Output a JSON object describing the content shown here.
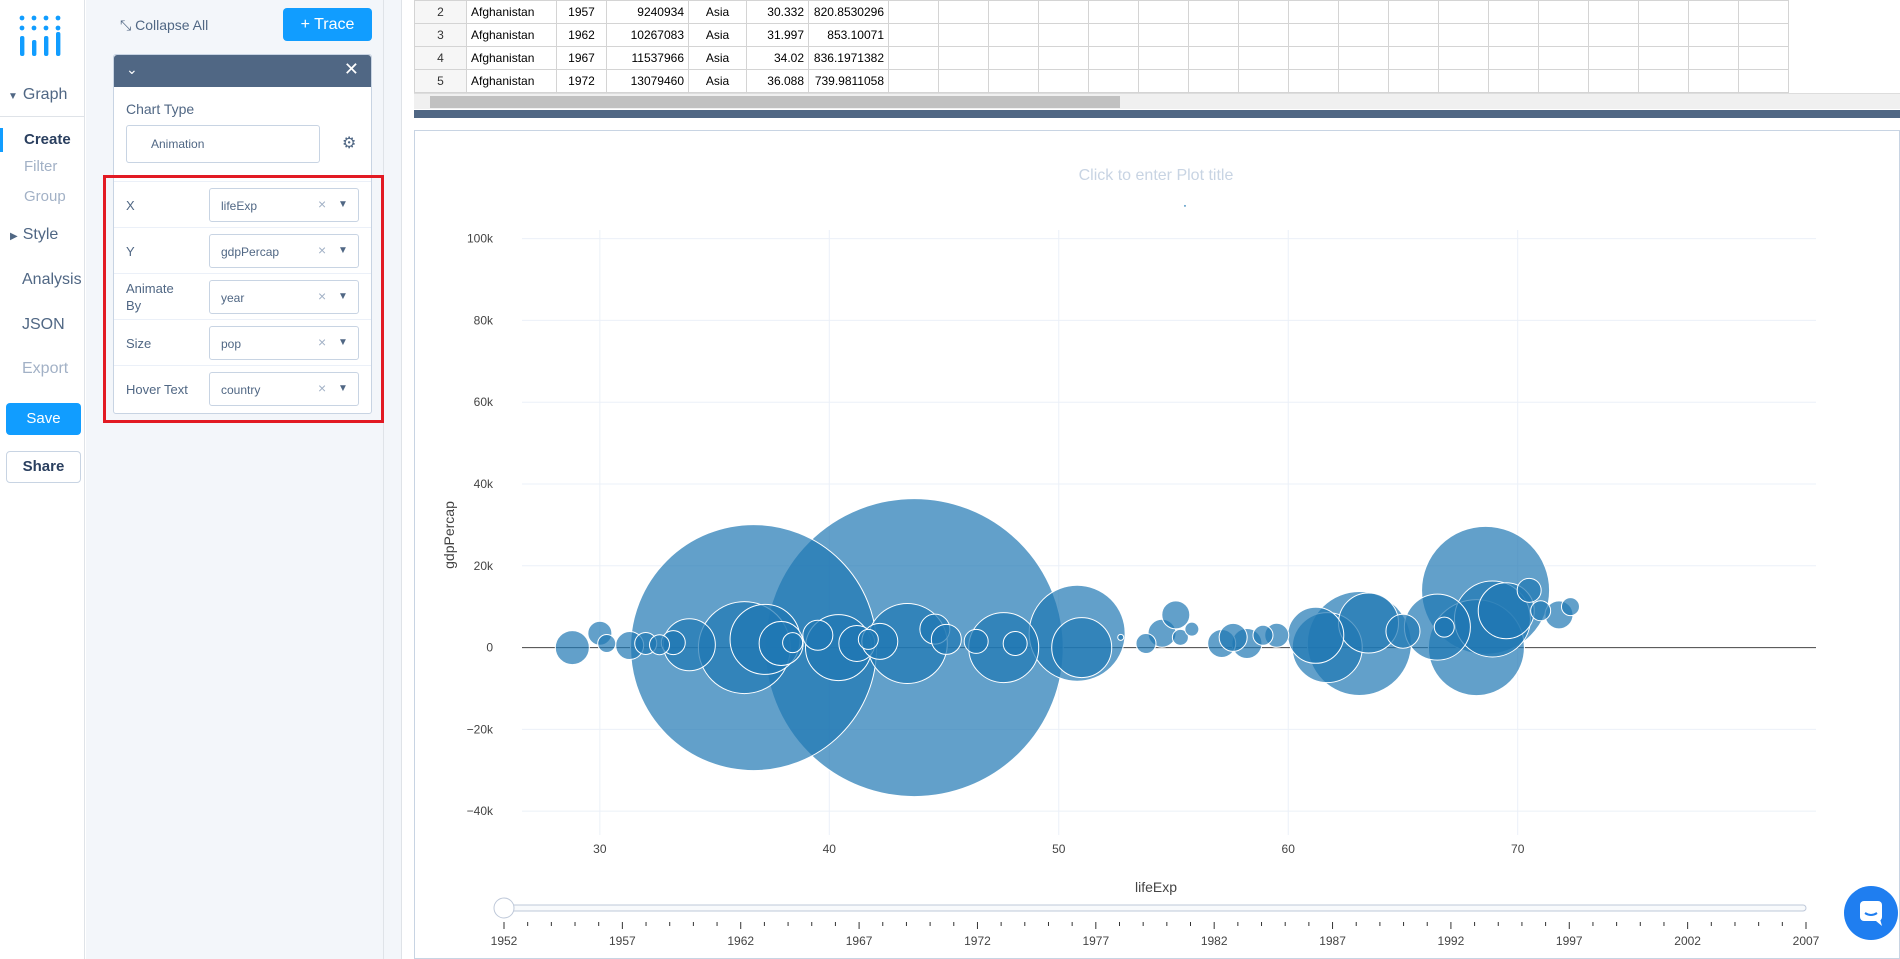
{
  "nav": {
    "graph_label": "Graph",
    "create_label": "Create",
    "filter_label": "Filter",
    "group_label": "Group",
    "style_label": "Style",
    "analysis_label": "Analysis",
    "json_label": "JSON",
    "export_label": "Export",
    "save_label": "Save",
    "share_label": "Share"
  },
  "panel": {
    "collapse_all_label": "Collapse All",
    "add_trace_label": "+ Trace",
    "chart_type_label": "Chart Type",
    "chart_type_value": "Animation",
    "fields": [
      {
        "label": "X",
        "value": "lifeExp"
      },
      {
        "label": "Y",
        "value": "gdpPercap"
      },
      {
        "label": "Animate By",
        "value": "year"
      },
      {
        "label": "Size",
        "value": "pop"
      },
      {
        "label": "Hover Text",
        "value": "country"
      }
    ]
  },
  "grid": {
    "rows": [
      {
        "n": "2",
        "country": "Afghanistan",
        "year": "1957",
        "pop": "9240934",
        "continent": "Asia",
        "lifeExp": "30.332",
        "gdpPercap": "820.8530296"
      },
      {
        "n": "3",
        "country": "Afghanistan",
        "year": "1962",
        "pop": "10267083",
        "continent": "Asia",
        "lifeExp": "31.997",
        "gdpPercap": "853.10071"
      },
      {
        "n": "4",
        "country": "Afghanistan",
        "year": "1967",
        "pop": "11537966",
        "continent": "Asia",
        "lifeExp": "34.02",
        "gdpPercap": "836.1971382"
      },
      {
        "n": "5",
        "country": "Afghanistan",
        "year": "1972",
        "pop": "13079460",
        "continent": "Asia",
        "lifeExp": "36.088",
        "gdpPercap": "739.9811058"
      }
    ]
  },
  "plot": {
    "title_placeholder": "Click to enter Plot title",
    "marker_color": "#1f77b4",
    "accent_color": "#119dff",
    "slider_years": [
      "1952",
      "1957",
      "1962",
      "1967",
      "1972",
      "1977",
      "1982",
      "1987",
      "1992",
      "1997",
      "2002",
      "2007"
    ],
    "slider_current": "1952"
  },
  "chart_data": {
    "type": "scatter",
    "xlabel": "lifeExp",
    "ylabel": "gdpPercap",
    "xlim": [
      25.3,
      83
    ],
    "ylim": [
      -49500,
      118000
    ],
    "x_ticks": [
      30,
      40,
      50,
      60,
      70
    ],
    "y_ticks": [
      -40000,
      -20000,
      0,
      20000,
      40000,
      60000,
      80000,
      100000
    ],
    "y_tick_labels": [
      "−40k",
      "−20k",
      "0",
      "20k",
      "40k",
      "60k",
      "80k",
      "100k"
    ],
    "grid": true,
    "points": [
      {
        "x": 28.8,
        "y": 0,
        "r": 17
      },
      {
        "x": 30.0,
        "y": 3500,
        "r": 12
      },
      {
        "x": 30.3,
        "y": 1000,
        "r": 9
      },
      {
        "x": 31.3,
        "y": 500,
        "r": 14
      },
      {
        "x": 32.0,
        "y": 1000,
        "r": 11
      },
      {
        "x": 32.6,
        "y": 700,
        "r": 10
      },
      {
        "x": 33.2,
        "y": 1200,
        "r": 12
      },
      {
        "x": 33.9,
        "y": 700,
        "r": 26
      },
      {
        "x": 36.3,
        "y": 0,
        "r": 46
      },
      {
        "x": 36.7,
        "y": 0,
        "r": 123
      },
      {
        "x": 37.2,
        "y": 2000,
        "r": 35
      },
      {
        "x": 37.9,
        "y": 1000,
        "r": 22
      },
      {
        "x": 38.4,
        "y": 1200,
        "r": 10
      },
      {
        "x": 39.5,
        "y": 3000,
        "r": 15
      },
      {
        "x": 40.4,
        "y": 0,
        "r": 33
      },
      {
        "x": 41.2,
        "y": 1000,
        "r": 18
      },
      {
        "x": 41.7,
        "y": 2000,
        "r": 10
      },
      {
        "x": 42.2,
        "y": 1500,
        "r": 18
      },
      {
        "x": 43.4,
        "y": 1000,
        "r": 40
      },
      {
        "x": 43.7,
        "y": 0,
        "r": 149
      },
      {
        "x": 44.6,
        "y": 4500,
        "r": 15
      },
      {
        "x": 45.1,
        "y": 2000,
        "r": 15
      },
      {
        "x": 46.4,
        "y": 1500,
        "r": 12
      },
      {
        "x": 47.6,
        "y": 0,
        "r": 35
      },
      {
        "x": 48.1,
        "y": 1000,
        "r": 12
      },
      {
        "x": 50.8,
        "y": 3500,
        "r": 48
      },
      {
        "x": 51.0,
        "y": 0,
        "r": 30
      },
      {
        "x": 52.7,
        "y": 2500,
        "r": 3
      },
      {
        "x": 53.8,
        "y": 1000,
        "r": 10
      },
      {
        "x": 54.5,
        "y": 3500,
        "r": 14
      },
      {
        "x": 55.1,
        "y": 8000,
        "r": 14
      },
      {
        "x": 55.3,
        "y": 2500,
        "r": 8
      },
      {
        "x": 55.5,
        "y": 108000,
        "r": 1.5
      },
      {
        "x": 55.8,
        "y": 4500,
        "r": 7
      },
      {
        "x": 57.1,
        "y": 1000,
        "r": 14
      },
      {
        "x": 57.6,
        "y": 2500,
        "r": 14
      },
      {
        "x": 58.2,
        "y": 1000,
        "r": 15
      },
      {
        "x": 58.9,
        "y": 3000,
        "r": 10
      },
      {
        "x": 59.5,
        "y": 3000,
        "r": 12
      },
      {
        "x": 61.2,
        "y": 3000,
        "r": 28
      },
      {
        "x": 61.7,
        "y": 0,
        "r": 35
      },
      {
        "x": 63.1,
        "y": 1000,
        "r": 52
      },
      {
        "x": 63.5,
        "y": 6000,
        "r": 30
      },
      {
        "x": 65.0,
        "y": 4000,
        "r": 17
      },
      {
        "x": 66.5,
        "y": 5000,
        "r": 33
      },
      {
        "x": 66.8,
        "y": 5000,
        "r": 10
      },
      {
        "x": 68.2,
        "y": 0,
        "r": 48
      },
      {
        "x": 68.6,
        "y": 14000,
        "r": 64
      },
      {
        "x": 68.9,
        "y": 7000,
        "r": 38
      },
      {
        "x": 69.5,
        "y": 9000,
        "r": 28
      },
      {
        "x": 70.5,
        "y": 14000,
        "r": 12
      },
      {
        "x": 71.0,
        "y": 9000,
        "r": 10
      },
      {
        "x": 71.8,
        "y": 8000,
        "r": 14
      },
      {
        "x": 72.3,
        "y": 10000,
        "r": 9
      }
    ]
  }
}
